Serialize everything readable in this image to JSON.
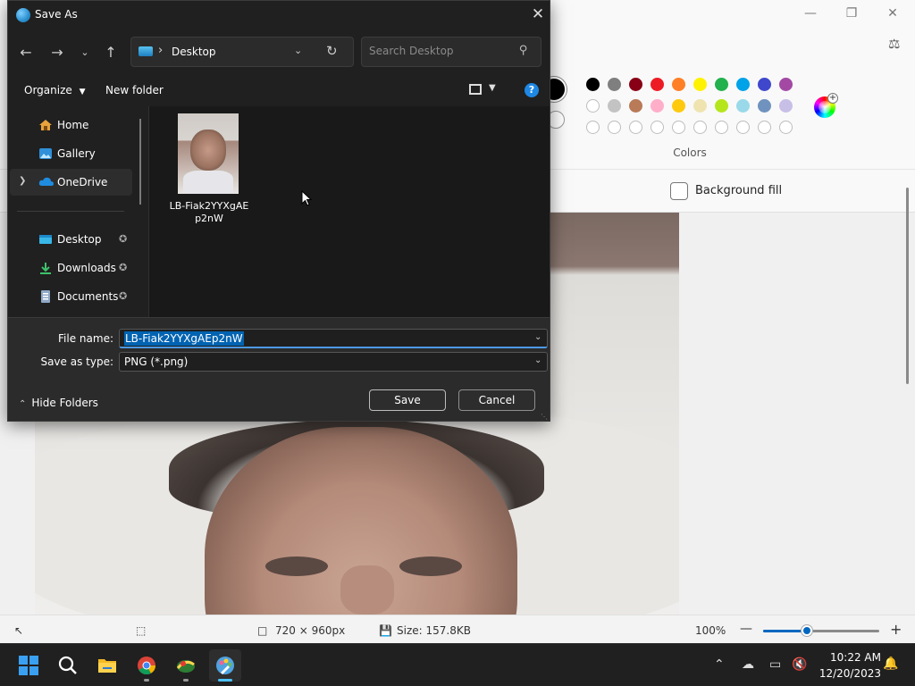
{
  "paint": {
    "colors_label": "Colors",
    "background_fill_label": "Background fill",
    "palette": {
      "row1": [
        "#000000",
        "#7f7f7f",
        "#880015",
        "#ed1c24",
        "#ff7f27",
        "#fff200",
        "#22b14c",
        "#00a2e8",
        "#3f48cc",
        "#a349a4"
      ],
      "row2": [
        "#ffffff",
        "#c3c3c3",
        "#b97a57",
        "#ffaec9",
        "#ffc90e",
        "#efe4b0",
        "#b5e61d",
        "#99d9ea",
        "#7092be",
        "#c8bfe7"
      ],
      "row3_empty_count": 10
    },
    "status": {
      "canvas_size": "720 × 960px",
      "file_size": "Size: 157.8KB",
      "zoom": "100%",
      "zoom_slider_fraction": 0.38
    }
  },
  "dialog": {
    "title": "Save As",
    "address": {
      "location": "Desktop"
    },
    "search": {
      "placeholder": "Search Desktop"
    },
    "toolbar": {
      "organize_label": "Organize",
      "new_folder_label": "New folder"
    },
    "nav_items": [
      {
        "label": "Home",
        "icon": "home-icon",
        "pinned": false
      },
      {
        "label": "Gallery",
        "icon": "gallery-icon",
        "pinned": false
      },
      {
        "label": "OneDrive",
        "icon": "cloud-icon",
        "pinned": false,
        "selected": true,
        "expandable": true
      },
      {
        "label": "Desktop",
        "icon": "desktop-icon",
        "pinned": true
      },
      {
        "label": "Downloads",
        "icon": "download-icon",
        "pinned": true
      },
      {
        "label": "Documents",
        "icon": "document-icon",
        "pinned": true
      }
    ],
    "files": [
      {
        "name": "LB-Fiak2YYXgAEp2nW"
      }
    ],
    "file_name_label": "File name:",
    "file_name_value": "LB-Fiak2YYXgAEp2nW",
    "save_type_label": "Save as type:",
    "save_type_value": "PNG (*.png)",
    "hide_folders_label": "Hide Folders",
    "save_label": "Save",
    "cancel_label": "Cancel"
  },
  "taskbar": {
    "apps": [
      "start-icon",
      "search-icon",
      "file-explorer-icon",
      "chrome-icon",
      "photos-icon",
      "paint-icon"
    ],
    "time": "10:22 AM",
    "date": "12/20/2023"
  }
}
